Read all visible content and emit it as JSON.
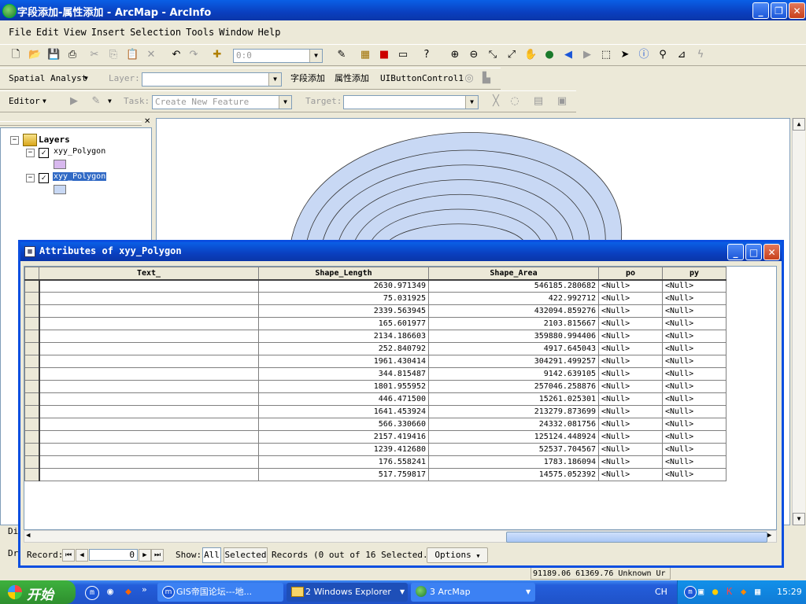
{
  "window": {
    "title": "字段添加-属性添加 - ArcMap - ArcInfo"
  },
  "menu": [
    "File",
    "Edit",
    "View",
    "Insert",
    "Selection",
    "Tools",
    "Window",
    "Help"
  ],
  "standard_toolbar": {
    "scale_value": "0:0"
  },
  "spatial_toolbar": {
    "spatial_analyst": "Spatial Analyst",
    "layer_label": "Layer:",
    "cmd1": "字段添加",
    "cmd2": "属性添加",
    "cmd3": "UIButtonControl1"
  },
  "editor_toolbar": {
    "editor": "Editor",
    "task_label": "Task:",
    "task_value": "Create New Feature",
    "target_label": "Target:"
  },
  "toc": {
    "root": "Layers",
    "layers": [
      {
        "name": "xyy_Polygon",
        "swatch": "#d8b8ee"
      },
      {
        "name": "xyy_Polygon",
        "swatch": "#c8d8f4"
      }
    ]
  },
  "attributes": {
    "title": "Attributes of xyy_Polygon",
    "columns": [
      "Text_",
      "Shape_Length",
      "Shape_Area",
      "po",
      "py"
    ],
    "rows": [
      [
        "",
        "2630.971349",
        "546185.280682",
        "<Null>",
        "<Null>"
      ],
      [
        "",
        "75.031925",
        "422.992712",
        "<Null>",
        "<Null>"
      ],
      [
        "",
        "2339.563945",
        "432094.859276",
        "<Null>",
        "<Null>"
      ],
      [
        "",
        "165.601977",
        "2103.815667",
        "<Null>",
        "<Null>"
      ],
      [
        "",
        "2134.186603",
        "359880.994406",
        "<Null>",
        "<Null>"
      ],
      [
        "",
        "252.840792",
        "4917.645043",
        "<Null>",
        "<Null>"
      ],
      [
        "",
        "1961.430414",
        "304291.499257",
        "<Null>",
        "<Null>"
      ],
      [
        "",
        "344.815487",
        "9142.639105",
        "<Null>",
        "<Null>"
      ],
      [
        "",
        "1801.955952",
        "257046.258876",
        "<Null>",
        "<Null>"
      ],
      [
        "",
        "446.471500",
        "15261.025301",
        "<Null>",
        "<Null>"
      ],
      [
        "",
        "1641.453924",
        "213279.873699",
        "<Null>",
        "<Null>"
      ],
      [
        "",
        "566.330660",
        "24332.081756",
        "<Null>",
        "<Null>"
      ],
      [
        "",
        "2157.419416",
        "125124.448924",
        "<Null>",
        "<Null>"
      ],
      [
        "",
        "1239.412680",
        "52537.704567",
        "<Null>",
        "<Null>"
      ],
      [
        "",
        "176.558241",
        "1783.186094",
        "<Null>",
        "<Null>"
      ],
      [
        "",
        "517.759817",
        "14575.052392",
        "<Null>",
        "<Null>"
      ]
    ],
    "footer": {
      "record_label": "Record:",
      "record_value": "0",
      "show_label": "Show:",
      "all_label": "All",
      "selected_label": "Selected",
      "records_text": "Records (0 out of 16 Selected.)",
      "options_label": "Options"
    }
  },
  "statusbar": {
    "coords": "91189.06  61369.76 Unknown Ur"
  },
  "side_labels": {
    "di": "Di",
    "dr": "Dr"
  },
  "taskbar": {
    "start": "开始",
    "tasks": [
      "GIS帝国论坛---地...",
      "2 Windows Explorer",
      "3 ArcMap"
    ],
    "lang": "CH",
    "time": "15:29"
  },
  "colors": {
    "polygon_fill": "#c8d8f4",
    "titlebar": "#0a4ee0"
  }
}
